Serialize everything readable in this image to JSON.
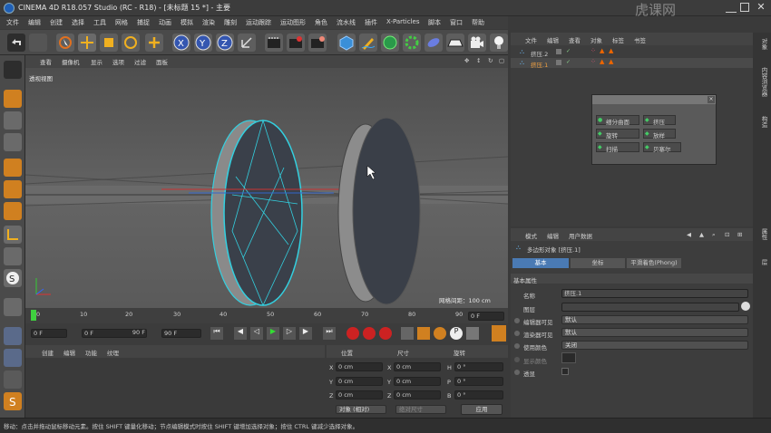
{
  "window": {
    "title": "CINEMA 4D R18.057 Studio (RC - R18) - [未标题 15 *] - 主要",
    "controls": [
      "minimize",
      "maximize",
      "close"
    ]
  },
  "watermark": "虎课网",
  "menu": [
    "文件",
    "编辑",
    "创建",
    "选择",
    "工具",
    "网格",
    "捕捉",
    "动画",
    "模拟",
    "渲染",
    "雕刻",
    "运动跟踪",
    "运动图形",
    "角色",
    "流水线",
    "插件",
    "X-Particles",
    "脚本",
    "窗口",
    "帮助"
  ],
  "toolbar_icons": [
    "undo-icon",
    "redo-icon",
    "select-icon",
    "move-icon",
    "scale-icon",
    "rotate-icon",
    "add-icon",
    "x-axis-icon",
    "y-axis-icon",
    "z-axis-icon",
    "coordinate-icon",
    "render-view-icon",
    "render-icon",
    "render-settings-icon",
    "cube-icon",
    "pen-icon",
    "subdivision-icon",
    "array-icon",
    "deformer-icon",
    "floor-icon",
    "camera-icon",
    "light-icon"
  ],
  "viewport": {
    "menu": [
      "查看",
      "摄像机",
      "显示",
      "选项",
      "过滤",
      "面板"
    ],
    "label": "透视视图",
    "grid_info": "网格间距：100 cm"
  },
  "timeline": {
    "ticks": [
      "0",
      "10",
      "20",
      "30",
      "40",
      "50",
      "60",
      "70",
      "80",
      "90"
    ],
    "end_frame": "0 F"
  },
  "playback": {
    "current": "0 F",
    "start": "0 F",
    "end": "90 F",
    "end2": "90 F"
  },
  "material_panel": {
    "menu": [
      "创建",
      "编辑",
      "功能",
      "纹理"
    ]
  },
  "coords": {
    "headers": [
      "位置",
      "尺寸",
      "旋转"
    ],
    "rows": [
      {
        "axis": "X",
        "pos": "0 cm",
        "size_axis": "X",
        "size": "0 cm",
        "rot_axis": "H",
        "rot": "0 °"
      },
      {
        "axis": "Y",
        "pos": "0 cm",
        "size_axis": "Y",
        "size": "0 cm",
        "rot_axis": "P",
        "rot": "0 °"
      },
      {
        "axis": "Z",
        "pos": "0 cm",
        "size_axis": "Z",
        "size": "0 cm",
        "rot_axis": "B",
        "rot": "0 °"
      }
    ],
    "mode": "对象 (相对)",
    "size_mode": "绝对尺寸",
    "apply": "应用"
  },
  "object_manager": {
    "menu": [
      "文件",
      "编辑",
      "查看",
      "对象",
      "标签",
      "书签"
    ],
    "objects": [
      {
        "name": "挤压.2"
      },
      {
        "name": "挤压.1"
      }
    ]
  },
  "popup": {
    "items": [
      "细分曲面",
      "挤压",
      "旋转",
      "放样",
      "扫描",
      "贝塞尔"
    ]
  },
  "attribute_manager": {
    "menu": [
      "模式",
      "编辑",
      "用户数据"
    ],
    "object_title": "多边形对象 [挤压.1]",
    "tabs": [
      "基本",
      "坐标",
      "平滑着色(Phong)"
    ],
    "section": "基本属性",
    "fields": [
      {
        "label": "名称",
        "value": "挤压.1"
      },
      {
        "label": "图层",
        "value": ""
      },
      {
        "label": "编辑器可见",
        "value": "默认"
      },
      {
        "label": "渲染器可见",
        "value": "默认"
      },
      {
        "label": "使用颜色",
        "value": "关闭"
      },
      {
        "label": "显示颜色",
        "value": ""
      },
      {
        "label": "透显",
        "value": ""
      }
    ]
  },
  "right_strip": [
    "对象",
    "内容浏览器",
    "构造",
    "属性",
    "层"
  ],
  "status": "移动：点击并拖动鼠标移动元素。按住 SHIFT 键量化移动；节点编辑模式时按住 SHIFT 键增加选择对象；按住 CTRL 键减少选择对象。"
}
